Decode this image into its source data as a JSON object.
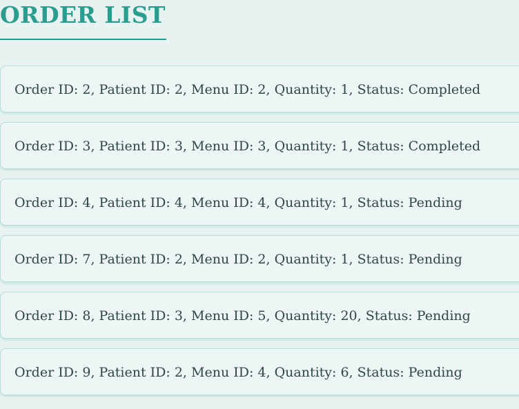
{
  "page": {
    "title": "ORDER LIST"
  },
  "orders": [
    {
      "text": "Order ID: 2, Patient ID: 2, Menu ID: 2, Quantity: 1, Status: Completed"
    },
    {
      "text": "Order ID: 3, Patient ID: 3, Menu ID: 3, Quantity: 1, Status: Completed"
    },
    {
      "text": "Order ID: 4, Patient ID: 4, Menu ID: 4, Quantity: 1, Status: Pending"
    },
    {
      "text": "Order ID: 7, Patient ID: 2, Menu ID: 2, Quantity: 1, Status: Pending"
    },
    {
      "text": "Order ID: 8, Patient ID: 3, Menu ID: 5, Quantity: 20, Status: Pending"
    },
    {
      "text": "Order ID: 9, Patient ID: 2, Menu ID: 4, Quantity: 6, Status: Pending"
    }
  ],
  "colors": {
    "accent": "#2a9d8f",
    "background": "#e8f3f1",
    "card_background": "#edf6f4",
    "card_border": "#b7ddd6",
    "text": "#2f4547"
  }
}
